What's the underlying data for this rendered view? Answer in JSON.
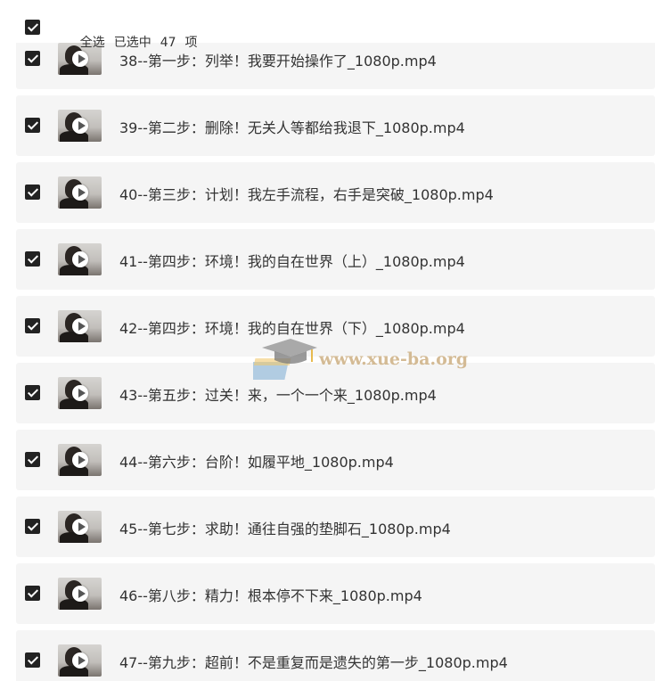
{
  "select_all": {
    "label": "全选",
    "selected_prefix": "已选中",
    "selected_count": "47",
    "selected_suffix": "项",
    "checked": true
  },
  "files": [
    {
      "name": "38--第一步：列举！我要开始操作了_1080p.mp4",
      "checked": true
    },
    {
      "name": "39--第二步：删除！无关人等都给我退下_1080p.mp4",
      "checked": true
    },
    {
      "name": "40--第三步：计划！我左手流程，右手是突破_1080p.mp4",
      "checked": true
    },
    {
      "name": "41--第四步：环境！我的自在世界（上）_1080p.mp4",
      "checked": true
    },
    {
      "name": "42--第四步：环境！我的自在世界（下）_1080p.mp4",
      "checked": true
    },
    {
      "name": "43--第五步：过关！来，一个一个来_1080p.mp4",
      "checked": true
    },
    {
      "name": "44--第六步：台阶！如履平地_1080p.mp4",
      "checked": true
    },
    {
      "name": "45--第七步：求助！通往自强的垫脚石_1080p.mp4",
      "checked": true
    },
    {
      "name": "46--第八步：精力！根本停不下来_1080p.mp4",
      "checked": true
    },
    {
      "name": "47--第九步：超前！不是重复而是遗失的第一步_1080p.mp4",
      "checked": true
    }
  ],
  "icons": {
    "checkbox": "checkbox-checked-icon",
    "thumbnail_play": "play-icon",
    "watermark_logo": "graduation-cap-icon"
  },
  "watermark": {
    "text": "www.xue-ba.org"
  },
  "colors": {
    "row_background": "#f5f5f5",
    "checkbox": "#222222",
    "text": "#333333",
    "watermark_text": "#cdaf82"
  }
}
